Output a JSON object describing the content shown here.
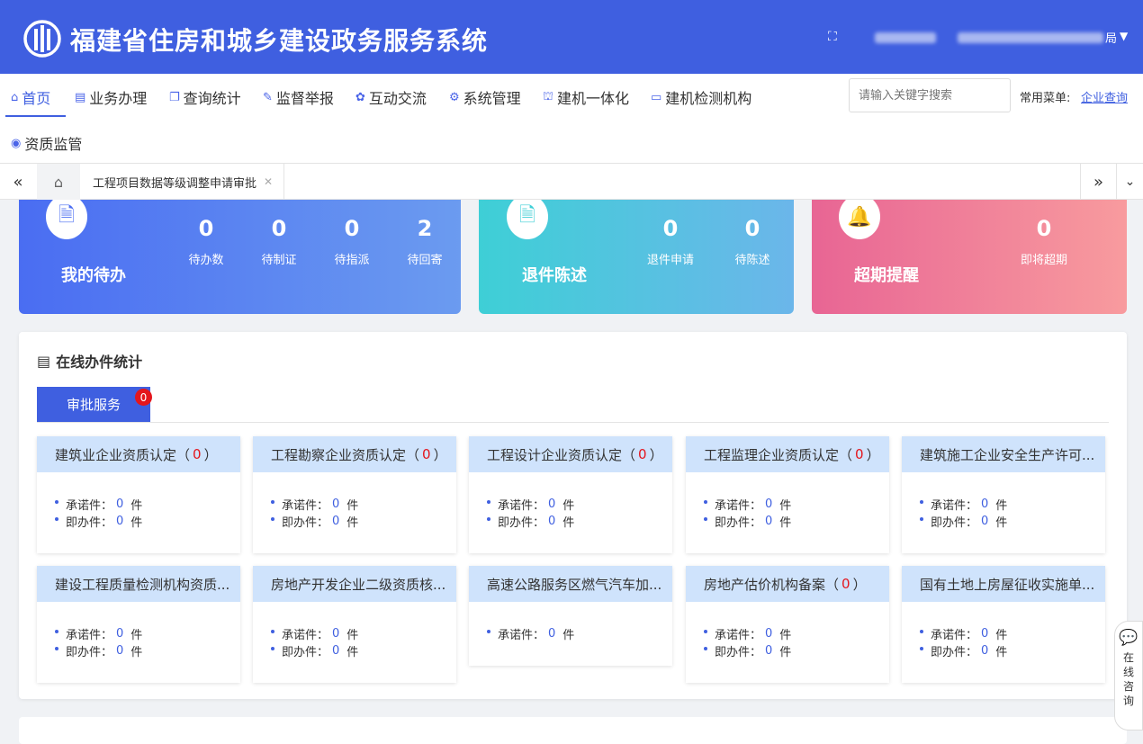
{
  "header": {
    "title": "福建省住房和城乡建设政务服务系统",
    "user_suffix": "局"
  },
  "nav": {
    "items": [
      {
        "label": "首页",
        "icon": "home-icon"
      },
      {
        "label": "业务办理",
        "icon": "list-icon"
      },
      {
        "label": "查询统计",
        "icon": "copy-icon"
      },
      {
        "label": "监督举报",
        "icon": "pen-icon"
      },
      {
        "label": "互动交流",
        "icon": "chat-icon"
      },
      {
        "label": "系统管理",
        "icon": "gear-icon"
      },
      {
        "label": "建机一体化",
        "icon": "crane-icon"
      },
      {
        "label": "建机检测机构",
        "icon": "id-card-icon"
      },
      {
        "label": "资质监管",
        "icon": "eye-icon"
      }
    ],
    "search_placeholder": "请输入关键字搜索",
    "common_menu_label": "常用菜单:",
    "common_menu_link": "企业查询"
  },
  "tabs": {
    "open_tab": "工程项目数据等级调整申请审批"
  },
  "cards": {
    "todo": {
      "title": "我的待办",
      "stats": [
        {
          "value": "0",
          "label": "待办数"
        },
        {
          "value": "0",
          "label": "待制证"
        },
        {
          "value": "0",
          "label": "待指派"
        },
        {
          "value": "2",
          "label": "待回寄"
        }
      ]
    },
    "returns": {
      "title": "退件陈述",
      "stats": [
        {
          "value": "0",
          "label": "退件申请"
        },
        {
          "value": "0",
          "label": "待陈述"
        }
      ]
    },
    "overdue": {
      "title": "超期提醒",
      "stats": [
        {
          "value": "0",
          "label": "即将超期"
        }
      ]
    }
  },
  "panel": {
    "title": "在线办件统计",
    "tab_label": "审批服务",
    "tab_badge": "0",
    "promise_label": "承诺件：",
    "instant_label": "即办件：",
    "unit": "件",
    "services": [
      {
        "name": "建筑业企业资质认定",
        "count": "0",
        "promise": "0",
        "instant": "0"
      },
      {
        "name": "工程勘察企业资质认定",
        "count": "0",
        "promise": "0",
        "instant": "0"
      },
      {
        "name": "工程设计企业资质认定",
        "count": "0",
        "promise": "0",
        "instant": "0"
      },
      {
        "name": "工程监理企业资质认定",
        "count": "0",
        "promise": "0",
        "instant": "0"
      },
      {
        "name": "建筑施工企业安全生产许可...",
        "count": "",
        "promise": "0",
        "instant": "0"
      },
      {
        "name": "建设工程质量检测机构资质...",
        "count": "",
        "promise": "0",
        "instant": "0"
      },
      {
        "name": "房地产开发企业二级资质核...",
        "count": "",
        "promise": "0",
        "instant": "0"
      },
      {
        "name": "高速公路服务区燃气汽车加...",
        "count": "",
        "promise": "0",
        "instant": null
      },
      {
        "name": "房地产估价机构备案",
        "count": "0",
        "promise": "0",
        "instant": "0"
      },
      {
        "name": "国有土地上房屋征收实施单...",
        "count": "",
        "promise": "0",
        "instant": "0"
      }
    ]
  },
  "consult": {
    "label": "在线咨询"
  },
  "colors": {
    "primary": "#3f5fe0",
    "badge_red": "#e4161d",
    "service_head": "#cfe3fc"
  }
}
